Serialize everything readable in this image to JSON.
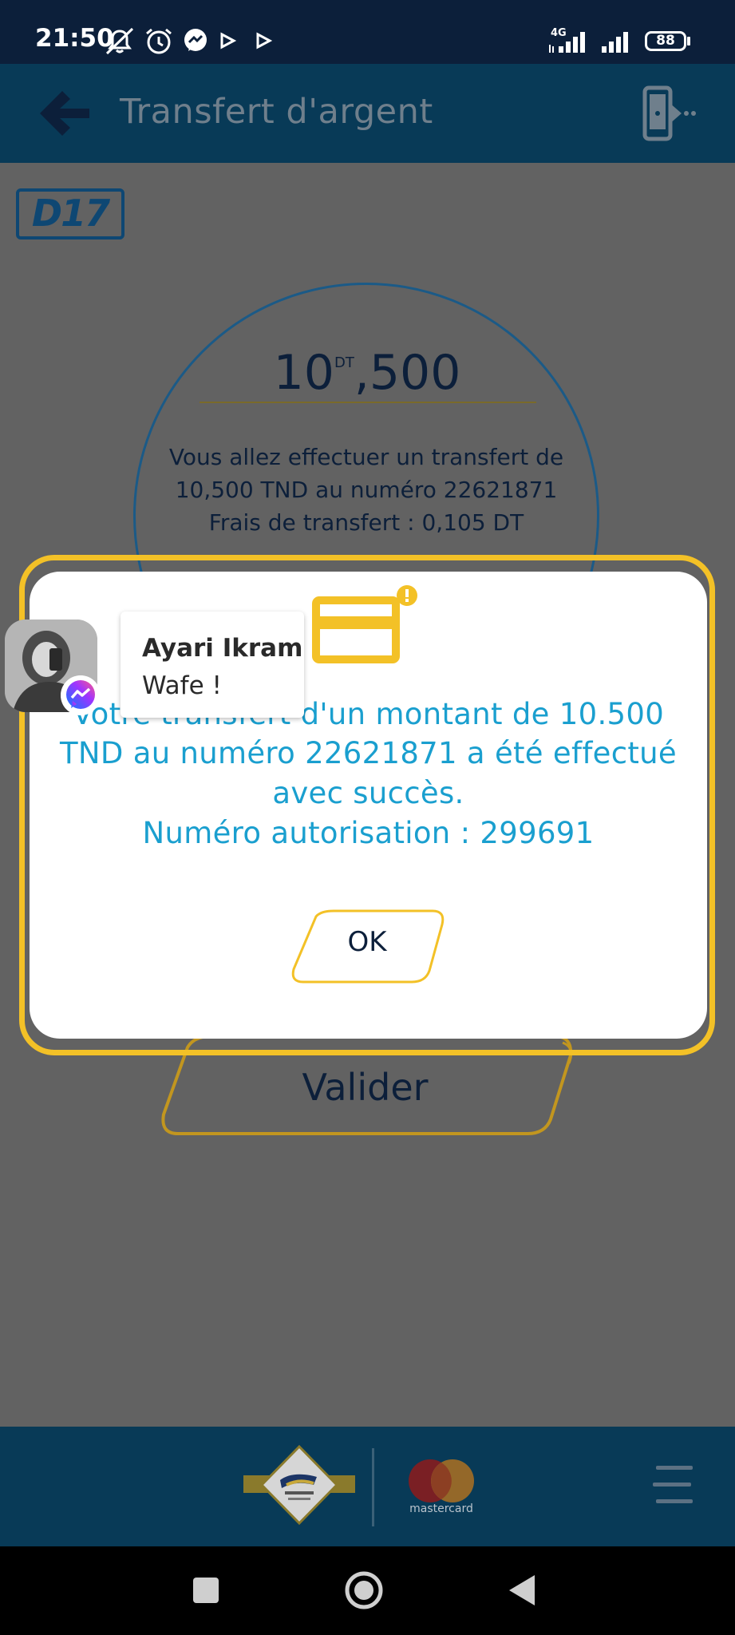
{
  "status_bar": {
    "time": "21:50",
    "network": "4G",
    "battery": "88",
    "battery_level": 0.88,
    "icons": [
      "mute-icon",
      "alarm-icon",
      "messenger-icon",
      "play-icon",
      "play-icon",
      "signal-icon",
      "signal-icon",
      "battery-icon"
    ]
  },
  "app_bar": {
    "title": "Transfert d'argent",
    "back_icon": "back-arrow-icon",
    "action_icon": "phone-transfer-icon"
  },
  "logo": {
    "text": "D17"
  },
  "transfer": {
    "amount_int": "10",
    "currency_small": "DT",
    "amount_dec": ",500",
    "info_line1": "Vous allez effectuer un transfert de",
    "info_line2": "10,500 TND au numéro 22621871",
    "info_line3": "Frais de transfert : 0,105 DT"
  },
  "dialog": {
    "icon": "credit-card-icon",
    "line1": "Votre transfert d'un montant de 10.500",
    "line2": "TND au numéro 22621871 a été effectué",
    "line3": "avec succès.",
    "line4": "Numéro autorisation : 299691",
    "ok_label": "OK"
  },
  "valider_label": "Valider",
  "chat_head": {
    "name": "Ayari Ikram",
    "message": "Wafe !"
  },
  "footer": {
    "mastercard_text": "mastercard",
    "menu_icon": "hamburger-menu-icon"
  },
  "colors": {
    "status_bar": "#0c1f3a",
    "app_bar": "#083a57",
    "accent_yellow": "#f3c127",
    "dialog_text": "#1a9fcf",
    "dark_text": "#0c1f3a"
  }
}
